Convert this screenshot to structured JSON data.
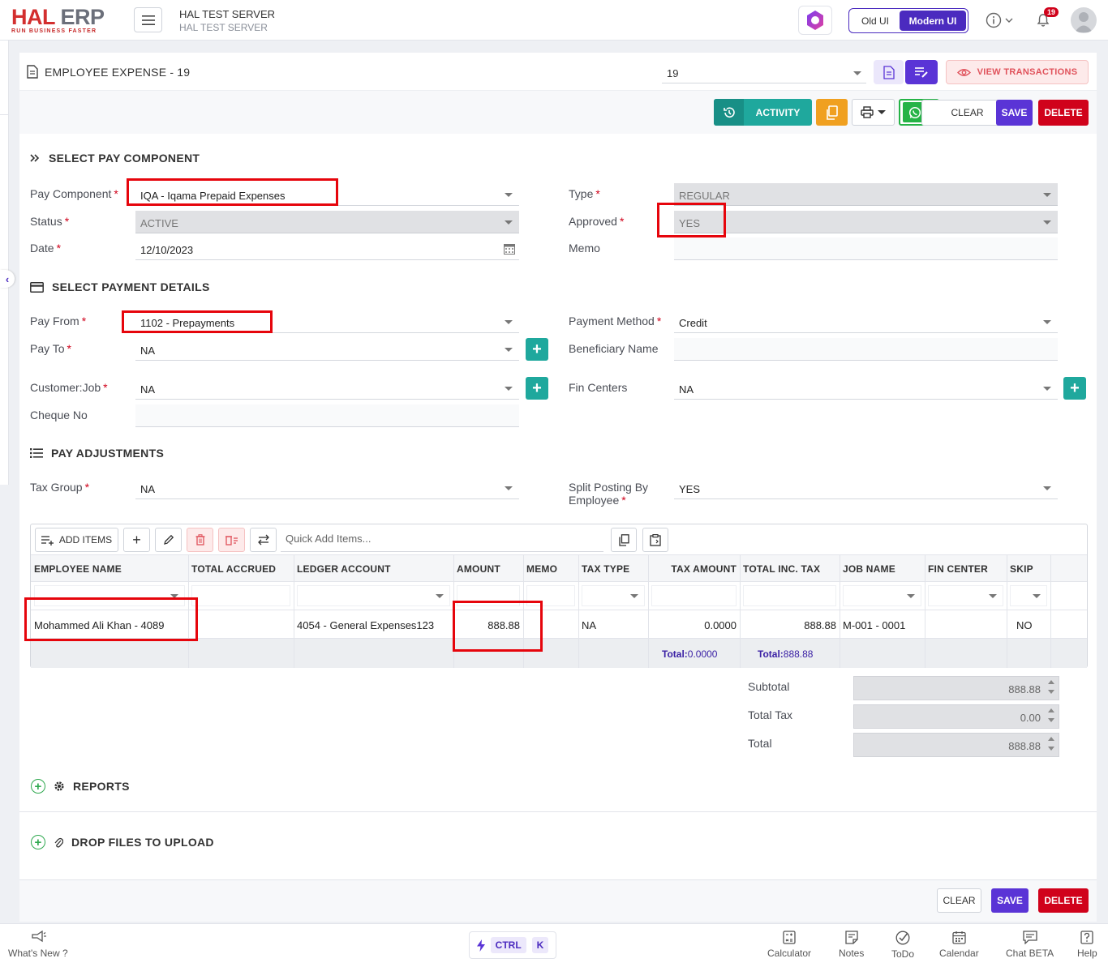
{
  "app": {
    "logo_main": "HAL",
    "logo_accent": "ERP",
    "logo_tagline": "RUN BUSINESS FASTER",
    "server_name": "HAL TEST SERVER",
    "server_sub": "HAL TEST SERVER",
    "ui_old": "Old UI",
    "ui_modern": "Modern UI",
    "notification_count": "19"
  },
  "page": {
    "title": "EMPLOYEE EXPENSE - 19",
    "record_select": "19",
    "view_transactions": "VIEW TRANSACTIONS",
    "activity": "ACTIVITY",
    "clear": "CLEAR",
    "save": "SAVE",
    "delete": "DELETE"
  },
  "pay_component_section": {
    "title": "SELECT PAY COMPONENT",
    "pay_component_label": "Pay Component",
    "pay_component_value": "IQA - Iqama Prepaid Expenses",
    "status_label": "Status",
    "status_value": "ACTIVE",
    "date_label": "Date",
    "date_value": "12/10/2023",
    "type_label": "Type",
    "type_value": "REGULAR",
    "approved_label": "Approved",
    "approved_value": "YES",
    "memo_label": "Memo",
    "memo_value": ""
  },
  "payment_section": {
    "title": "SELECT PAYMENT DETAILS",
    "pay_from_label": "Pay From",
    "pay_from_value": "1102 - Prepayments",
    "pay_to_label": "Pay To",
    "pay_to_value": "NA",
    "customer_job_label": "Customer:Job",
    "customer_job_value": "NA",
    "cheque_no_label": "Cheque No",
    "cheque_no_value": "",
    "payment_method_label": "Payment Method",
    "payment_method_value": "Credit",
    "beneficiary_label": "Beneficiary Name",
    "beneficiary_value": "",
    "fin_centers_label": "Fin Centers",
    "fin_centers_value": "NA"
  },
  "adjust_section": {
    "title": "PAY ADJUSTMENTS",
    "tax_group_label": "Tax Group",
    "tax_group_value": "NA",
    "split_label_1": "Split Posting By",
    "split_label_2": "Employee",
    "split_value": "YES"
  },
  "grid": {
    "add_items": "ADD ITEMS",
    "quick_add_placeholder": "Quick Add Items...",
    "columns": [
      "EMPLOYEE NAME",
      "TOTAL ACCRUED",
      "LEDGER ACCOUNT",
      "AMOUNT",
      "MEMO",
      "TAX TYPE",
      "TAX AMOUNT",
      "TOTAL INC. TAX",
      "JOB NAME",
      "FIN CENTER",
      "SKIP"
    ],
    "row": {
      "employee_name": "Mohammed Ali Khan - 4089",
      "total_accrued": "",
      "ledger_account": "4054 - General Expenses123",
      "amount": "888.88",
      "memo": "",
      "tax_type": "NA",
      "tax_amount": "0.0000",
      "total_inc_tax": "888.88",
      "job_name": "M-001 - 0001",
      "fin_center": "",
      "skip": "NO"
    },
    "total_label": "Total:",
    "tax_total": "0.0000",
    "inc_tax_total": "888.88"
  },
  "totals": {
    "subtotal_label": "Subtotal",
    "subtotal_value": "888.88",
    "total_tax_label": "Total Tax",
    "total_tax_value": "0.00",
    "total_label": "Total",
    "total_value": "888.88"
  },
  "sections": {
    "reports": "REPORTS",
    "drop_files": "DROP FILES TO UPLOAD"
  },
  "bottom": {
    "whats_new": "What's New ?",
    "ctrl": "CTRL",
    "k": "K",
    "calculator": "Calculator",
    "notes": "Notes",
    "todo": "ToDo",
    "calendar": "Calendar",
    "chat": "Chat BETA",
    "help": "Help"
  }
}
